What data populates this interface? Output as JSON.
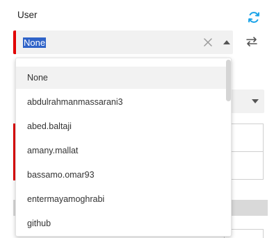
{
  "field": {
    "label": "User",
    "selected_value": "None"
  },
  "icons": {
    "refresh": "refresh-icon",
    "clear": "close-icon",
    "caret": "caret-up-icon",
    "swap": "swap-arrows-icon"
  },
  "colors": {
    "required_bar": "#e10000",
    "accent": "#1aa3e8",
    "selection_highlight": "#2f63c8"
  },
  "dropdown": {
    "options": [
      "None",
      "abdulrahmanmassarani3",
      "abed.baltaji",
      "amany.mallat",
      "bassamo.omar93",
      "entermayamoghrabi",
      "github"
    ],
    "selected_index": 0
  }
}
